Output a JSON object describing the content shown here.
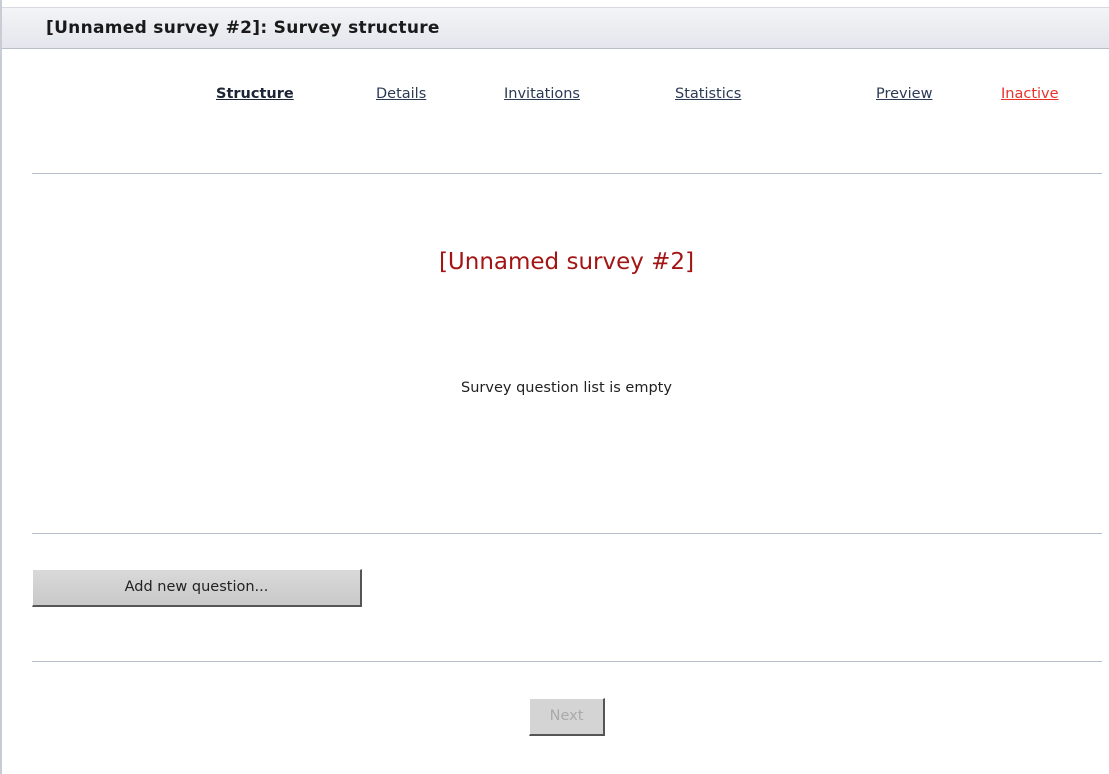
{
  "header": {
    "title": "[Unnamed survey #2]: Survey structure"
  },
  "nav": {
    "structure": "Structure",
    "details": "Details",
    "invitations": "Invitations",
    "statistics": "Statistics",
    "preview": "Preview",
    "status": "Inactive"
  },
  "main": {
    "survey_name": "[Unnamed survey #2]",
    "empty_message": "Survey question list is empty"
  },
  "actions": {
    "add_question_label": "Add new question...",
    "next_label": "Next"
  },
  "colors": {
    "survey_name": "#a31515",
    "status_inactive": "#e8322a",
    "link": "#2b3a55"
  }
}
